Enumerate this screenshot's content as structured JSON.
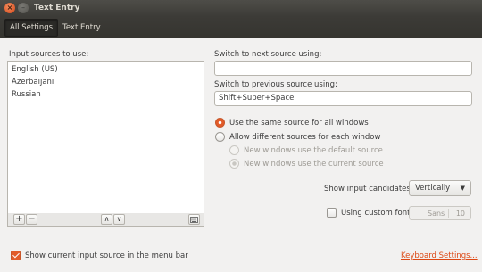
{
  "window": {
    "title": "Text Entry",
    "close_glyph": "×",
    "min_glyph": "–"
  },
  "toolbar": {
    "all_settings": "All Settings",
    "current": "Text Entry"
  },
  "input_sources": {
    "label": "Input sources to use:",
    "items": [
      "English (US)",
      "Azerbaijani",
      "Russian"
    ],
    "add_glyph": "+",
    "remove_glyph": "−",
    "up_glyph": "∧",
    "down_glyph": "∨",
    "keyboard_icon": "keyboard-icon"
  },
  "next_source": {
    "label": "Switch to next source using:",
    "value": ""
  },
  "prev_source": {
    "label": "Switch to previous source using:",
    "value": "Shift+Super+Space"
  },
  "window_mode": {
    "same": "Use the same source for all windows",
    "different": "Allow different sources for each window",
    "new_default": "New windows use the default source",
    "new_current": "New windows use the current source",
    "selected": "same"
  },
  "candidates": {
    "label": "Show input candidates:",
    "value": "Vertically",
    "arrow": "▼"
  },
  "custom_font": {
    "label": "Using custom font:",
    "checked": false,
    "font_name": "Sans",
    "font_size": "10"
  },
  "menu_bar": {
    "label": "Show current input source in the menu bar",
    "checked": true
  },
  "keyboard_settings": "Keyboard Settings...",
  "colors": {
    "accent": "#e25b29",
    "link": "#dd4814",
    "titlebar": "#3c3b37"
  }
}
